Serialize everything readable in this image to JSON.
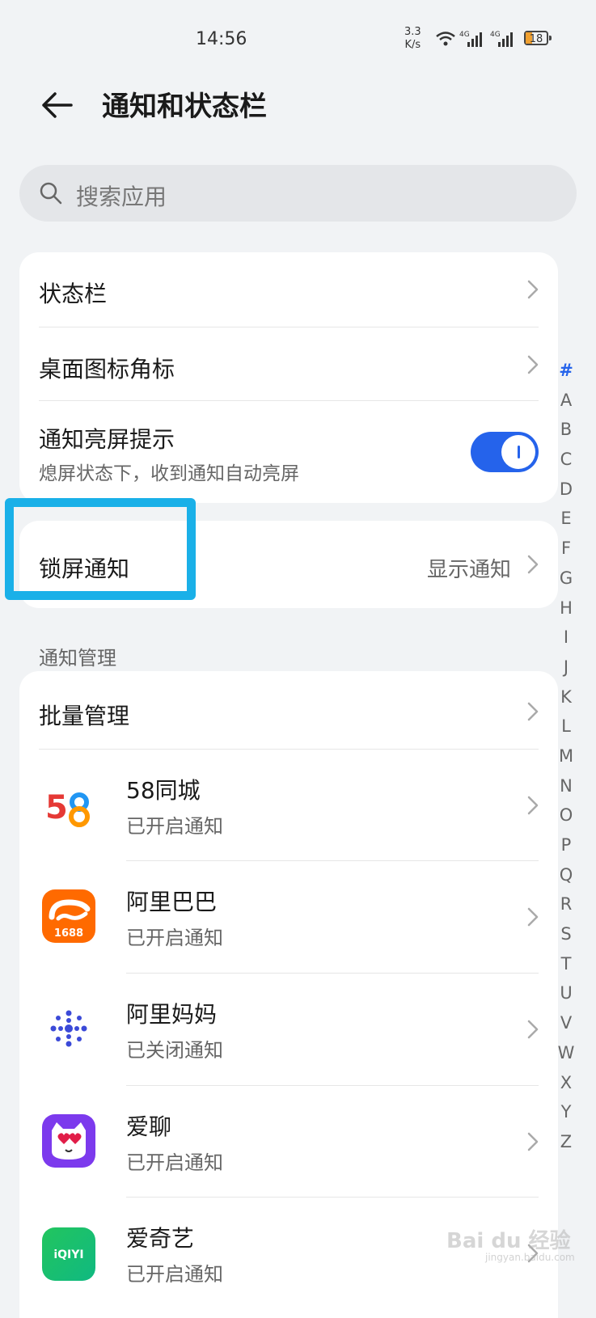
{
  "status_bar": {
    "time": "14:56",
    "net_speed_value": "3.3",
    "net_speed_unit": "K/s",
    "battery": "18",
    "sig1_label": "4G",
    "sig2_label": "4G"
  },
  "header": {
    "title": "通知和状态栏"
  },
  "search": {
    "placeholder": "搜索应用"
  },
  "settings_card": {
    "status_bar_label": "状态栏",
    "badge_label": "桌面图标角标",
    "wake_label": "通知亮屏提示",
    "wake_sub": "熄屏状态下，收到通知自动亮屏",
    "wake_enabled": true
  },
  "lock_card": {
    "label": "锁屏通知",
    "value": "显示通知"
  },
  "section": {
    "label": "通知管理"
  },
  "manage": {
    "batch_label": "批量管理",
    "apps": [
      {
        "name": "58同城",
        "status": "已开启通知",
        "icon": "app-58-icon"
      },
      {
        "name": "阿里巴巴",
        "status": "已开启通知",
        "icon": "app-1688-icon",
        "icon_text": "1688"
      },
      {
        "name": "阿里妈妈",
        "status": "已关闭通知",
        "icon": "app-alimama-icon"
      },
      {
        "name": "爱聊",
        "status": "已开启通知",
        "icon": "app-ailiao-icon"
      },
      {
        "name": "爱奇艺",
        "status": "已开启通知",
        "icon": "app-iqiyi-icon",
        "icon_text": "iQIYI"
      }
    ]
  },
  "index_letters": [
    "#",
    "A",
    "B",
    "C",
    "D",
    "E",
    "F",
    "G",
    "H",
    "I",
    "J",
    "K",
    "L",
    "M",
    "N",
    "O",
    "P",
    "Q",
    "R",
    "S",
    "T",
    "U",
    "V",
    "W",
    "X",
    "Y",
    "Z"
  ],
  "index_active": "#",
  "watermark": {
    "text": "Bai du 经验",
    "sub": "jingyan.baidu.com"
  },
  "colors": {
    "accent": "#2563eb",
    "highlight": "#1ab0e8",
    "background": "#f1f3f5"
  }
}
